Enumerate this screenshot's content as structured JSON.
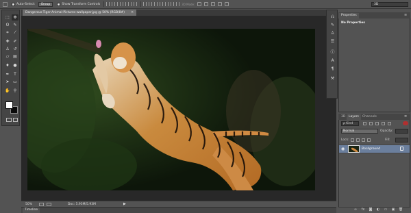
{
  "options_bar": {
    "auto_select_label": "Auto-Select:",
    "auto_select_value": "Group",
    "transform_controls_label": "Show Transform Controls",
    "mode_label": "3D Mode:",
    "workspace": "3D"
  },
  "document": {
    "tab_title": "Dangerous-Tiger-Animal-Pictures-wallpaper.jpg @ 50% (RGB/8#)",
    "close_glyph": "×"
  },
  "status_bar": {
    "zoom": "50%",
    "doc_size": "Doc: 5.93M/5.93M",
    "arrow": "▶"
  },
  "timeline": {
    "label": "Timeline"
  },
  "properties": {
    "tab_label": "Properties",
    "empty_text": "No Properties",
    "menu_glyph": "≡"
  },
  "layers": {
    "tabs": [
      "3D",
      "Layers",
      "Channels"
    ],
    "active_tab": "Layers",
    "menu_glyph": "≡",
    "filter_kind": "ρ Kind",
    "blend_mode": "Normal",
    "opacity_label": "Opacity:",
    "opacity_value": "",
    "lock_label": "Lock:",
    "fill_label": "Fill:",
    "fill_value": "",
    "layer_name": "Background"
  },
  "colors": {
    "accent_selected_layer": "#6b7f9d",
    "foreground": "#ffffff",
    "background": "#0a0a0a",
    "ui_gray": "#535353"
  },
  "icons": {
    "tools": [
      "move-icon",
      "marquee-icon",
      "lasso-icon",
      "quick-select-icon",
      "crop-icon",
      "eyedropper-icon",
      "healing-brush-icon",
      "brush-icon",
      "clone-stamp-icon",
      "history-brush-icon",
      "eraser-icon",
      "gradient-icon",
      "blur-icon",
      "dodge-icon",
      "pen-icon",
      "type-icon",
      "path-select-icon",
      "rectangle-icon",
      "hand-icon",
      "zoom-icon"
    ]
  }
}
